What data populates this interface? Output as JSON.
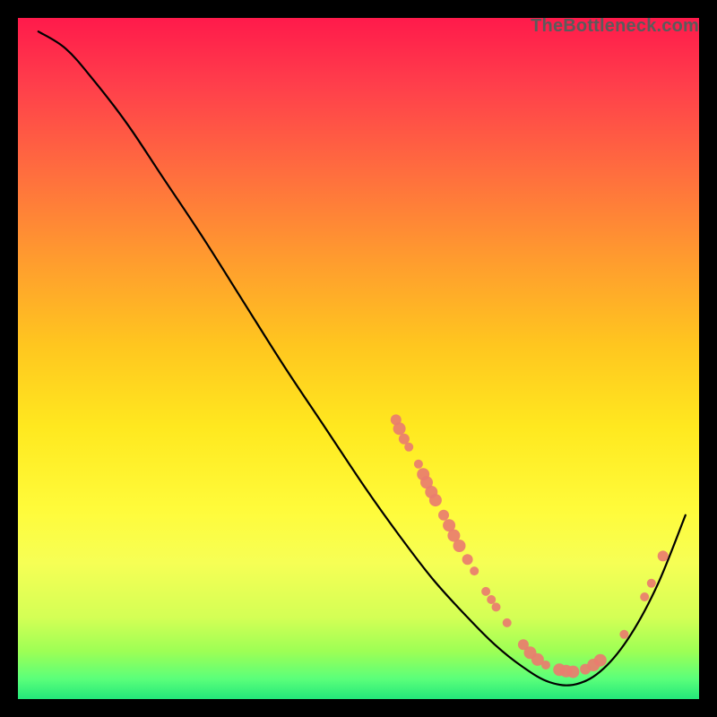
{
  "watermark": "TheBottleneck.com",
  "colors": {
    "background_black": "#000000",
    "marker": "#e97d6f",
    "curve": "#000000",
    "gradient_stops": [
      "#ff1a4b",
      "#ff3f4b",
      "#ff6b3f",
      "#ff9a2f",
      "#ffc61f",
      "#ffe81f",
      "#fffb3a",
      "#f6ff55",
      "#d4ff55",
      "#9dff55",
      "#5bff7a",
      "#23e87a"
    ]
  },
  "chart_data": {
    "type": "line",
    "title": "",
    "xlabel": "",
    "ylabel": "",
    "xlim": [
      0,
      1
    ],
    "ylim": [
      0,
      1
    ],
    "note": "Axes are normalized 0–1 in both directions; y encodes bottleneck severity (high=red near top, low=green near bottom). A single black curve descends from upper-left, reaches a floor near x≈0.78–0.84, then rises toward the right edge. Coral markers cluster along the curve in the lower-right region and a few on the rising tail.",
    "series": [
      {
        "name": "bottleneck-curve",
        "points": [
          {
            "x": 0.03,
            "y": 0.98
          },
          {
            "x": 0.07,
            "y": 0.955
          },
          {
            "x": 0.11,
            "y": 0.91
          },
          {
            "x": 0.16,
            "y": 0.845
          },
          {
            "x": 0.21,
            "y": 0.77
          },
          {
            "x": 0.27,
            "y": 0.68
          },
          {
            "x": 0.33,
            "y": 0.585
          },
          {
            "x": 0.39,
            "y": 0.49
          },
          {
            "x": 0.45,
            "y": 0.4
          },
          {
            "x": 0.51,
            "y": 0.31
          },
          {
            "x": 0.56,
            "y": 0.24
          },
          {
            "x": 0.61,
            "y": 0.175
          },
          {
            "x": 0.66,
            "y": 0.12
          },
          {
            "x": 0.7,
            "y": 0.08
          },
          {
            "x": 0.74,
            "y": 0.048
          },
          {
            "x": 0.78,
            "y": 0.025
          },
          {
            "x": 0.82,
            "y": 0.022
          },
          {
            "x": 0.86,
            "y": 0.045
          },
          {
            "x": 0.9,
            "y": 0.095
          },
          {
            "x": 0.94,
            "y": 0.17
          },
          {
            "x": 0.98,
            "y": 0.27
          }
        ]
      }
    ],
    "markers": [
      {
        "x": 0.555,
        "y": 0.41,
        "r": 6
      },
      {
        "x": 0.56,
        "y": 0.397,
        "r": 7
      },
      {
        "x": 0.567,
        "y": 0.382,
        "r": 6
      },
      {
        "x": 0.574,
        "y": 0.37,
        "r": 5
      },
      {
        "x": 0.588,
        "y": 0.345,
        "r": 5
      },
      {
        "x": 0.595,
        "y": 0.33,
        "r": 7
      },
      {
        "x": 0.6,
        "y": 0.318,
        "r": 7
      },
      {
        "x": 0.607,
        "y": 0.304,
        "r": 7
      },
      {
        "x": 0.613,
        "y": 0.292,
        "r": 7
      },
      {
        "x": 0.625,
        "y": 0.27,
        "r": 6
      },
      {
        "x": 0.633,
        "y": 0.255,
        "r": 7
      },
      {
        "x": 0.64,
        "y": 0.24,
        "r": 7
      },
      {
        "x": 0.648,
        "y": 0.225,
        "r": 7
      },
      {
        "x": 0.66,
        "y": 0.205,
        "r": 6
      },
      {
        "x": 0.67,
        "y": 0.188,
        "r": 5
      },
      {
        "x": 0.687,
        "y": 0.158,
        "r": 5
      },
      {
        "x": 0.695,
        "y": 0.146,
        "r": 5
      },
      {
        "x": 0.702,
        "y": 0.135,
        "r": 5
      },
      {
        "x": 0.718,
        "y": 0.112,
        "r": 5
      },
      {
        "x": 0.742,
        "y": 0.08,
        "r": 6
      },
      {
        "x": 0.752,
        "y": 0.068,
        "r": 7
      },
      {
        "x": 0.763,
        "y": 0.058,
        "r": 7
      },
      {
        "x": 0.775,
        "y": 0.05,
        "r": 5
      },
      {
        "x": 0.795,
        "y": 0.043,
        "r": 7
      },
      {
        "x": 0.805,
        "y": 0.041,
        "r": 7
      },
      {
        "x": 0.815,
        "y": 0.04,
        "r": 7
      },
      {
        "x": 0.833,
        "y": 0.044,
        "r": 6
      },
      {
        "x": 0.845,
        "y": 0.05,
        "r": 7
      },
      {
        "x": 0.855,
        "y": 0.057,
        "r": 7
      },
      {
        "x": 0.89,
        "y": 0.095,
        "r": 5
      },
      {
        "x": 0.92,
        "y": 0.15,
        "r": 5
      },
      {
        "x": 0.93,
        "y": 0.17,
        "r": 5
      },
      {
        "x": 0.947,
        "y": 0.21,
        "r": 6
      }
    ]
  }
}
